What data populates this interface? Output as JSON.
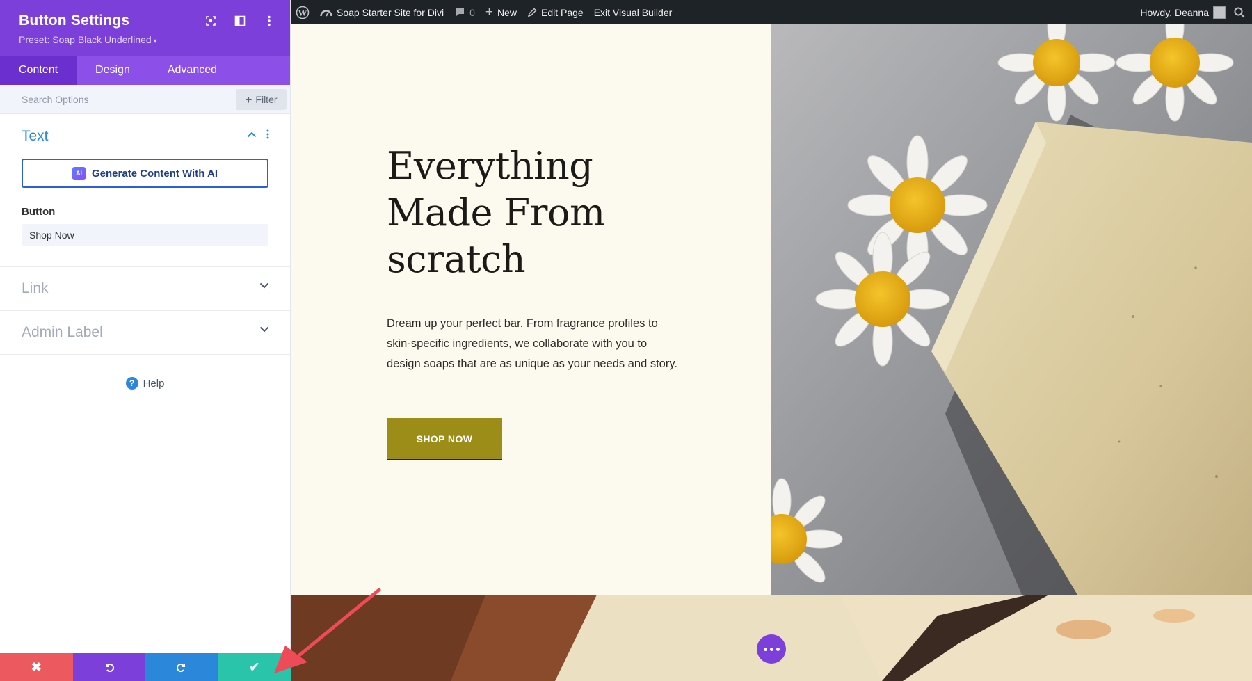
{
  "panel": {
    "title": "Button Settings",
    "preset": "Preset: Soap Black Underlined",
    "tabs": [
      "Content",
      "Design",
      "Advanced"
    ],
    "active_tab": "Content",
    "search_placeholder": "Search Options",
    "filter_label": "Filter",
    "sections": {
      "text": {
        "label": "Text",
        "expanded": true
      },
      "link": {
        "label": "Link",
        "expanded": false
      },
      "admin": {
        "label": "Admin Label",
        "expanded": false
      }
    },
    "ai_button": "Generate Content With AI",
    "ai_badge": "AI",
    "button_field_label": "Button",
    "button_field_value": "Shop Now",
    "help": "Help"
  },
  "footer": {
    "cancel_icon": "close-icon",
    "undo_icon": "undo-icon",
    "redo_icon": "redo-icon",
    "save_icon": "check-icon"
  },
  "adminbar": {
    "site_name": "Soap Starter Site for Divi",
    "comments_count": "0",
    "new": "New",
    "edit_page": "Edit Page",
    "exit_builder": "Exit Visual Builder",
    "greeting": "Howdy, Deanna"
  },
  "hero": {
    "title_lines": [
      "Everything",
      "Made From",
      "scratch"
    ],
    "body": "Dream up your perfect bar. From fragrance profiles to skin-specific ingredients, we collaborate with you to design soaps that are as unique as your needs and story.",
    "button": "SHOP NOW"
  },
  "colors": {
    "divi_purple": "#7c3fd9",
    "divi_blue": "#2b87da",
    "divi_red": "#ec5a5f",
    "divi_green": "#29c4a9",
    "hero_bg": "#fcf9ef",
    "shop_button": "#9c8c18",
    "annotation_arrow": "#ec4b57"
  }
}
